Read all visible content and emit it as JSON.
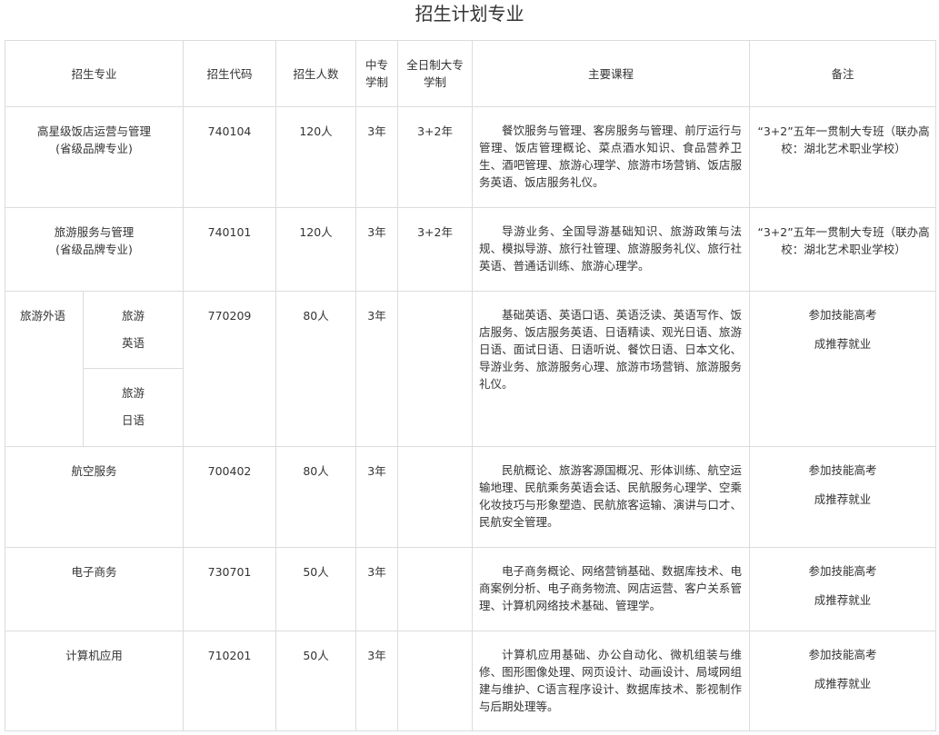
{
  "page": {
    "title": "招生计划专业"
  },
  "table": {
    "headers": {
      "major": "招生专业",
      "code": "招生代码",
      "count": "招生人数",
      "zz_1": "中专",
      "zz_2": "学制",
      "dz_1": "全日制大专",
      "dz_2": "学制",
      "courses": "主要课程",
      "note": "备注"
    },
    "rows": [
      {
        "major_1": "高星级饭店运营与管理",
        "major_2": "(省级品牌专业)",
        "code": "740104",
        "count": "120人",
        "zz": "3年",
        "dz": "3+2年",
        "courses": "餐饮服务与管理、客房服务与管理、前厅运行与管理、饭店管理概论、菜点酒水知识、食品营养卫生、酒吧管理、旅游心理学、旅游市场营销、饭店服务英语、饭店服务礼仪。",
        "note": "“3+2”五年一贯制大专班（联办高校：湖北艺术职业学校）"
      },
      {
        "major_1": "旅游服务与管理",
        "major_2": "(省级品牌专业)",
        "code": "740101",
        "count": "120人",
        "zz": "3年",
        "dz": "3+2年",
        "courses": "导游业务、全国导游基础知识、旅游政策与法规、模拟导游、旅行社管理、旅游服务礼仪、旅行社英语、普通话训练、旅游心理学。",
        "note": "“3+2”五年一贯制大专班（联办高校：湖北艺术职业学校）"
      },
      {
        "major_group": "旅游外语",
        "sub_1a": "旅游",
        "sub_1b": "英语",
        "sub_2a": "旅游",
        "sub_2b": "日语",
        "code": "770209",
        "count": "80人",
        "zz": "3年",
        "dz": "",
        "courses": "基础英语、英语口语、英语泛读、英语写作、饭店服务、饭店服务英语、日语精读、观光日语、旅游日语、面试日语、日语听说、餐饮日语、日本文化、导游业务、旅游服务心理、旅游市场营销、旅游服务礼仪。",
        "note_1": "参加技能高考",
        "note_2": "成推荐就业"
      },
      {
        "major": "航空服务",
        "code": "700402",
        "count": "80人",
        "zz": "3年",
        "dz": "",
        "courses": "民航概论、旅游客源国概况、形体训练、航空运输地理、民航乘务英语会话、民航服务心理学、空乘化妆技巧与形象塑造、民航旅客运输、演讲与口才、民航安全管理。",
        "note_1": "参加技能高考",
        "note_2": "成推荐就业"
      },
      {
        "major": "电子商务",
        "code": "730701",
        "count": "50人",
        "zz": "3年",
        "dz": "",
        "courses": "电子商务概论、网络营销基础、数据库技术、电商案例分析、电子商务物流、网店运营、客户关系管理、计算机网络技术基础、管理学。",
        "note_1": "参加技能高考",
        "note_2": "成推荐就业"
      },
      {
        "major": "计算机应用",
        "code": "710201",
        "count": "50人",
        "zz": "3年",
        "dz": "",
        "courses": "计算机应用基础、办公自动化、微机组装与维修、图形图像处理、网页设计、动画设计、局域网组建与维护、C语言程序设计、数据库技术、影视制作与后期处理等。",
        "note_1": "参加技能高考",
        "note_2": "成推荐就业"
      }
    ]
  }
}
